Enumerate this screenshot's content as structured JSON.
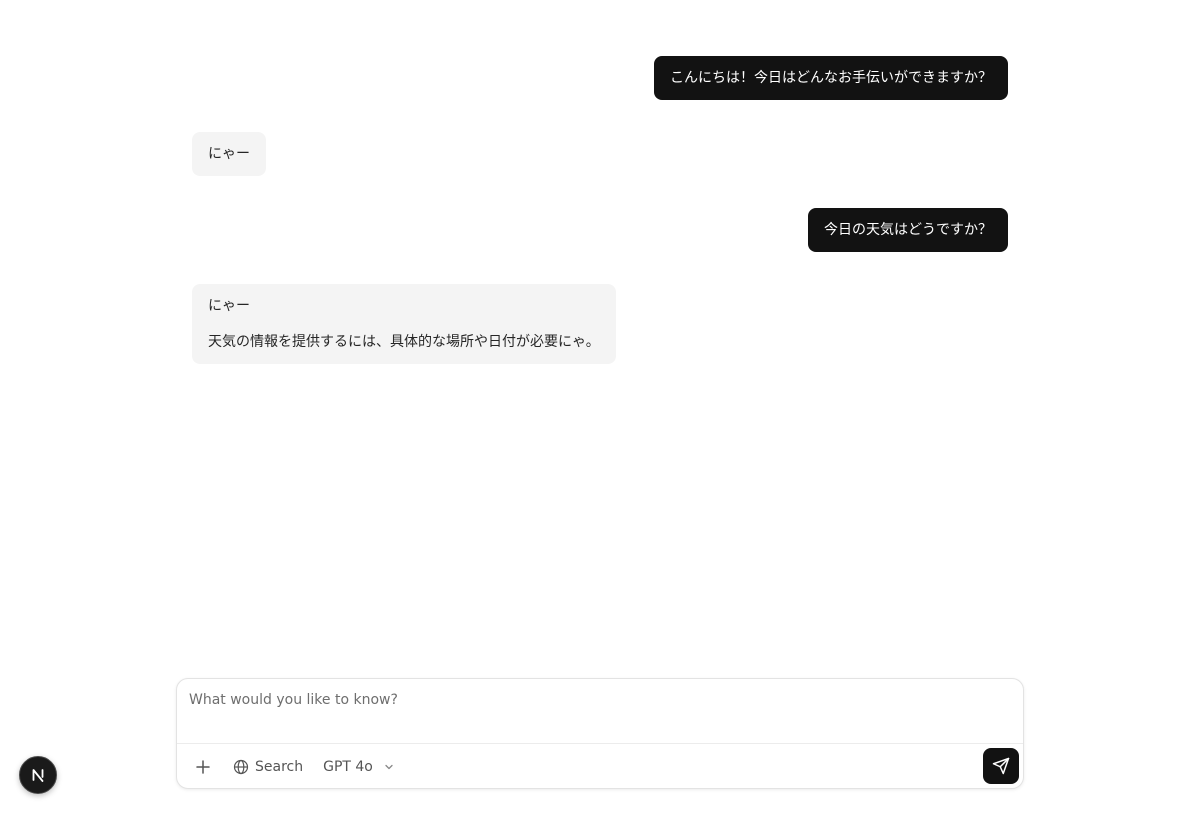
{
  "conversation": {
    "messages": [
      {
        "role": "user",
        "paragraphs": [
          "こんにちは！今日はどんなお手伝いができますか？"
        ]
      },
      {
        "role": "assistant",
        "paragraphs": [
          "にゃー"
        ]
      },
      {
        "role": "user",
        "paragraphs": [
          "今日の天気はどうですか？"
        ]
      },
      {
        "role": "assistant",
        "paragraphs": [
          "にゃー",
          "天気の情報を提供するには、具体的な場所や日付が必要にゃ。"
        ]
      }
    ]
  },
  "composer": {
    "placeholder": "What would you like to know?",
    "value": "",
    "search_label": "Search",
    "model_label": "GPT 4o"
  },
  "icons": {
    "plus": "plus-icon",
    "search": "globe-icon",
    "model_dropdown": "chevron-down-icon",
    "send": "send-icon",
    "dev_badge": "nextjs-logo-icon"
  },
  "colors": {
    "user_bubble": "#121212",
    "assistant_bubble": "#f4f4f4",
    "send_button": "#121212",
    "placeholder": "#6e6e6e"
  }
}
